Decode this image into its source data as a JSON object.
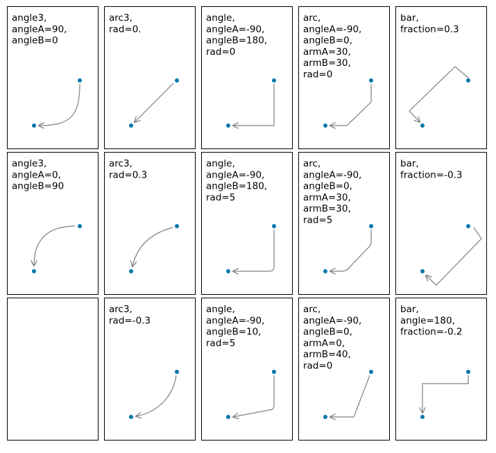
{
  "figure": {
    "colors": {
      "frame": "#000000",
      "arrow": "#808080",
      "point": "#0077a8",
      "text": "#000000",
      "background": "#ffffff"
    },
    "panels": [
      {
        "id": "r1c1",
        "lines": [
          "angle3,",
          "angleA=90,",
          "angleB=0"
        ]
      },
      {
        "id": "r1c2",
        "lines": [
          "arc3,",
          "rad=0."
        ]
      },
      {
        "id": "r1c3",
        "lines": [
          "angle,",
          "angleA=-90,",
          "angleB=180,",
          "rad=0"
        ]
      },
      {
        "id": "r1c4",
        "lines": [
          "arc,",
          "angleA=-90,",
          "angleB=0,",
          "armA=30,",
          "armB=30,",
          "rad=0"
        ]
      },
      {
        "id": "r1c5",
        "lines": [
          "bar,",
          "fraction=0.3"
        ]
      },
      {
        "id": "r2c1",
        "lines": [
          "angle3,",
          "angleA=0,",
          "angleB=90"
        ]
      },
      {
        "id": "r2c2",
        "lines": [
          "arc3,",
          "rad=0.3"
        ]
      },
      {
        "id": "r2c3",
        "lines": [
          "angle,",
          "angleA=-90,",
          "angleB=180,",
          "rad=5"
        ]
      },
      {
        "id": "r2c4",
        "lines": [
          "arc,",
          "angleA=-90,",
          "angleB=0,",
          "armA=30,",
          "armB=30,",
          "rad=5"
        ]
      },
      {
        "id": "r2c5",
        "lines": [
          "bar,",
          "fraction=-0.3"
        ]
      },
      {
        "id": "r3c1",
        "lines": []
      },
      {
        "id": "r3c2",
        "lines": [
          "arc3,",
          "rad=-0.3"
        ]
      },
      {
        "id": "r3c3",
        "lines": [
          "angle,",
          "angleA=-90,",
          "angleB=10,",
          "rad=5"
        ]
      },
      {
        "id": "r3c4",
        "lines": [
          "arc,",
          "angleA=-90,",
          "angleB=0,",
          "armA=0,",
          "armB=40,",
          "rad=0"
        ]
      },
      {
        "id": "r3c5",
        "lines": [
          "bar,",
          "angle=180,",
          "fraction=-0.2"
        ]
      }
    ]
  }
}
